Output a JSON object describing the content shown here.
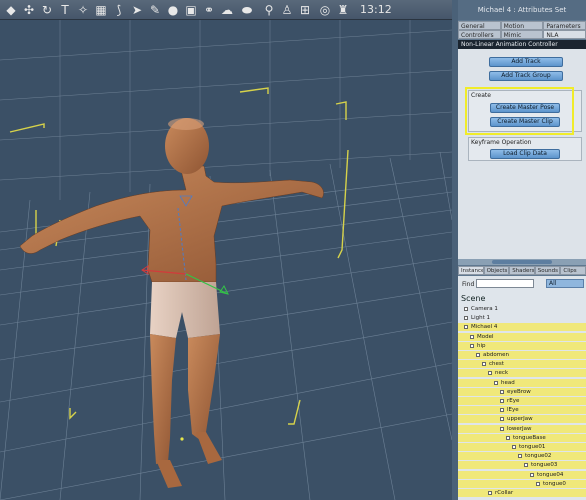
{
  "toolbar": {
    "clock": "13:12",
    "icons": [
      "shapes-icon",
      "morph-icon",
      "rotate-icon",
      "text-icon",
      "twist-icon",
      "translate-icon",
      "bend-icon",
      "pointer-icon",
      "paint-icon",
      "sphere-icon",
      "cubes-icon",
      "chain-icon",
      "cloud-icon",
      "blob-icon",
      "pin-icon",
      "figure-icon",
      "grid-icon",
      "camera-icon",
      "figure2-icon",
      "wrench-icon"
    ]
  },
  "panel": {
    "title": "Michael 4 : Attributes Set",
    "tabs_row1": [
      "General",
      "Motion",
      "Parameters"
    ],
    "tabs_row2": [
      "Controllers",
      "Mimic",
      "NLA"
    ],
    "nla_header": "Non-Linear Animation Controller",
    "add_track": "Add Track",
    "add_track_group": "Add Track Group",
    "create_label": "Create",
    "create_master_pose": "Create Master Pose",
    "create_master_clip": "Create Master Clip",
    "keyframe_label": "Keyframe Operation",
    "load_clip_data": "Load Clip Data"
  },
  "scene": {
    "tabs": [
      "Instances",
      "Objects",
      "Shaders",
      "Sounds",
      "Clips"
    ],
    "find_label": "Find",
    "find_value": "",
    "filter": "All",
    "title": "Scene",
    "tree": [
      {
        "label": "Camera 1",
        "depth": 0,
        "hl": false
      },
      {
        "label": "Light 1",
        "depth": 0,
        "hl": false
      },
      {
        "label": "Michael 4",
        "depth": 0,
        "hl": true
      },
      {
        "label": "Model",
        "depth": 1,
        "hl": true
      },
      {
        "label": "hip",
        "depth": 1,
        "hl": true
      },
      {
        "label": "abdomen",
        "depth": 2,
        "hl": true
      },
      {
        "label": "chest",
        "depth": 3,
        "hl": true
      },
      {
        "label": "neck",
        "depth": 4,
        "hl": true
      },
      {
        "label": "head",
        "depth": 5,
        "hl": true
      },
      {
        "label": "eyeBrow",
        "depth": 6,
        "hl": true
      },
      {
        "label": "rEye",
        "depth": 6,
        "hl": true
      },
      {
        "label": "lEye",
        "depth": 6,
        "hl": true
      },
      {
        "label": "upperJaw",
        "depth": 6,
        "hl": true
      },
      {
        "label": "lowerJaw",
        "depth": 6,
        "hl": true
      },
      {
        "label": "tongueBase",
        "depth": 7,
        "hl": true
      },
      {
        "label": "tongue01",
        "depth": 8,
        "hl": true
      },
      {
        "label": "tongue02",
        "depth": 9,
        "hl": true
      },
      {
        "label": "tongue03",
        "depth": 10,
        "hl": true
      },
      {
        "label": "tongue04",
        "depth": 11,
        "hl": true
      },
      {
        "label": "tongue0",
        "depth": 12,
        "hl": true
      },
      {
        "label": "rCollar",
        "depth": 4,
        "hl": true
      }
    ]
  }
}
